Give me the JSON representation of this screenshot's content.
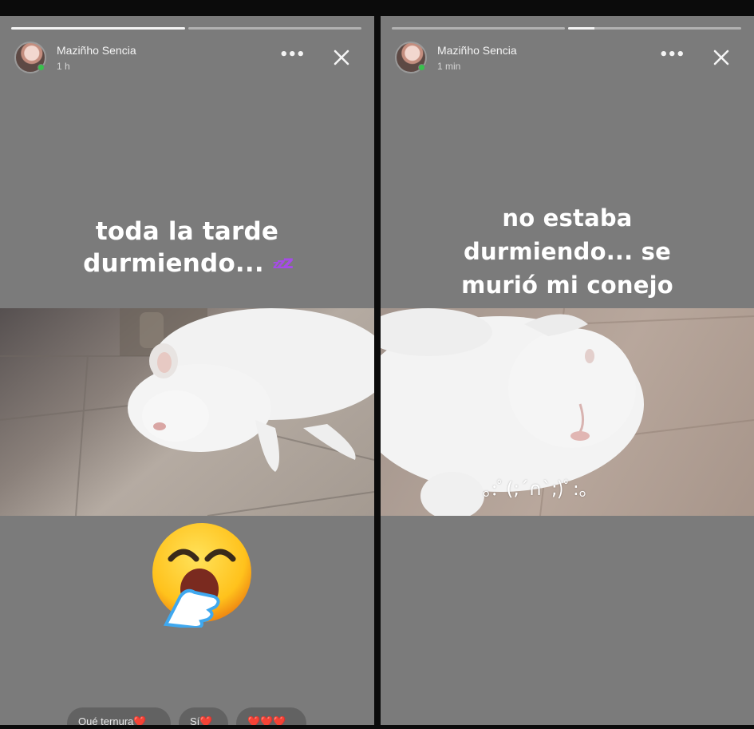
{
  "stories": [
    {
      "author": "Maziñho Sencia",
      "time": "1 h",
      "progress": [
        1.0,
        0.0
      ],
      "caption_line1": "toda la tarde",
      "caption_line2": "durmiendo...",
      "caption_emoji": "zzz",
      "photo": "white rabbit lying on a tiled floor",
      "sticker": "yawning-face-emoji",
      "quick_replies": [
        "Qué ternura❤️",
        "Sí❤️",
        "❤️❤️❤️"
      ]
    },
    {
      "author": "Maziñho Sencia",
      "time": "1 min",
      "progress": [
        0.0,
        0.15
      ],
      "caption_line1": "no estaba",
      "caption_line2": "durmiendo... se",
      "caption_line3": "murió mi conejo",
      "photo": "close-up of a white rabbit on a tiled floor",
      "kaomoji": "｡:ﾟ(;´∩`;)ﾟ:｡"
    }
  ],
  "icons": {
    "more": "more-options-icon",
    "close": "close-icon"
  },
  "colors": {
    "panel": "#7b7b7b",
    "zzz": "#a64be8",
    "text": "#ffffff"
  }
}
